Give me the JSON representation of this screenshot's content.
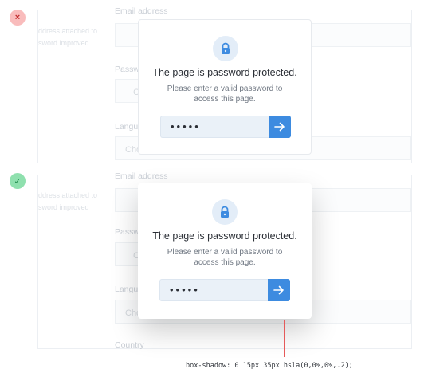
{
  "markers": {
    "bad_symbol": "×",
    "good_symbol": "✓",
    "bad_color": "#c0292b",
    "good_color": "#1f8a4c"
  },
  "background_form": {
    "email_label": "Email address",
    "hint_line1": "ddress attached to",
    "hint_line2": "sword improved",
    "password_label": "Passw",
    "choose_c": "C",
    "language_label": "Langu",
    "choose_placeholder": "Cho",
    "country_label": "Country"
  },
  "modal": {
    "icon": "lock-icon",
    "title": "The page is password protected.",
    "subtitle": "Please enter a valid password to access this page.",
    "password_value": "•••••",
    "submit_icon": "arrow-right-icon",
    "accent": "#3d8be0"
  },
  "caption": "box-shadow: 0 15px 35px hsla(0,0%,0%,.2);"
}
